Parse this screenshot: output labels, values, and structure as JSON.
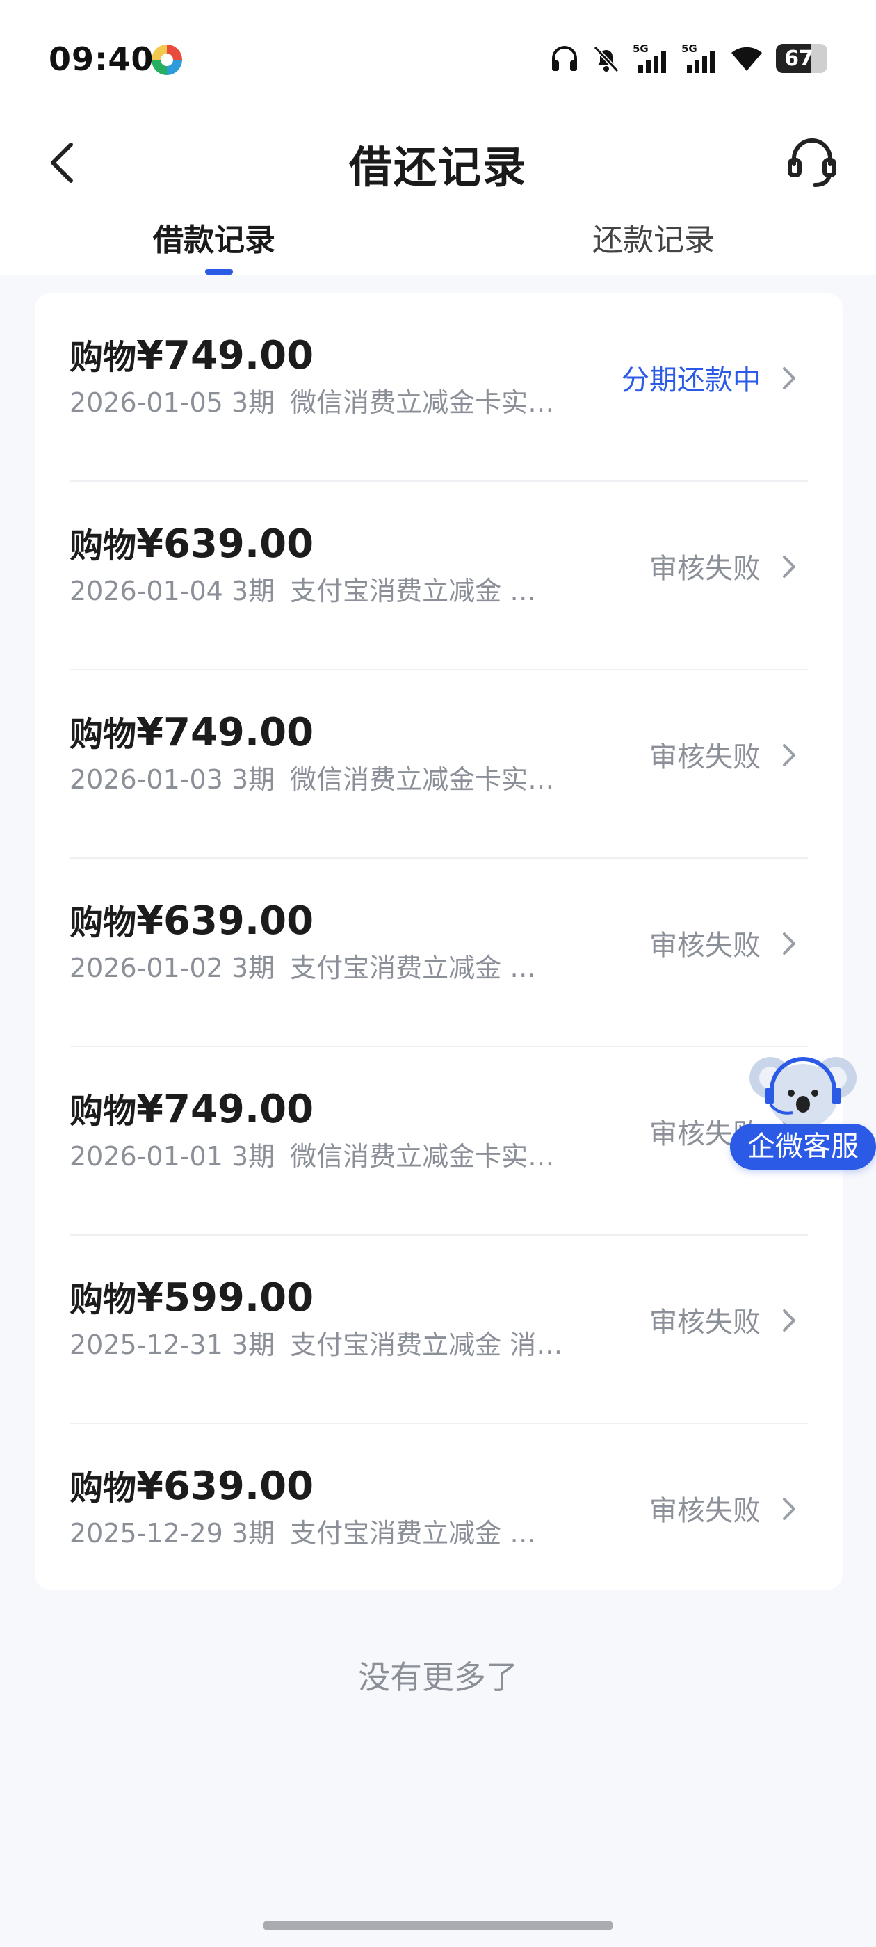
{
  "status_bar": {
    "time": "09:40",
    "network_1": "5G",
    "network_2": "5G",
    "battery_level": 67,
    "battery_label": "67",
    "icons": [
      "app-icon",
      "headphones-icon",
      "mute-bell-icon",
      "signal-5g-icon",
      "signal-5g-icon",
      "wifi-icon",
      "battery-icon"
    ]
  },
  "header": {
    "title": "借还记录",
    "back_icon": "chevron-left-icon",
    "support_icon": "headset-icon"
  },
  "tabs": [
    {
      "label": "借款记录",
      "active": true
    },
    {
      "label": "还款记录",
      "active": false
    }
  ],
  "records": [
    {
      "prefix": "购物",
      "amount": "¥749.00",
      "date": "2026-01-05",
      "term": "3期",
      "desc": "微信消费立减金卡实…",
      "status": "分期还款中",
      "status_active": true
    },
    {
      "prefix": "购物",
      "amount": "¥639.00",
      "date": "2026-01-04",
      "term": "3期",
      "desc": "支付宝消费立减金 …",
      "status": "审核失败",
      "status_active": false
    },
    {
      "prefix": "购物",
      "amount": "¥749.00",
      "date": "2026-01-03",
      "term": "3期",
      "desc": "微信消费立减金卡实…",
      "status": "审核失败",
      "status_active": false
    },
    {
      "prefix": "购物",
      "amount": "¥639.00",
      "date": "2026-01-02",
      "term": "3期",
      "desc": "支付宝消费立减金 …",
      "status": "审核失败",
      "status_active": false
    },
    {
      "prefix": "购物",
      "amount": "¥749.00",
      "date": "2026-01-01",
      "term": "3期",
      "desc": "微信消费立减金卡实…",
      "status": "审核失败",
      "status_active": false
    },
    {
      "prefix": "购物",
      "amount": "¥599.00",
      "date": "2025-12-31",
      "term": "3期",
      "desc": "支付宝消费立减金 消…",
      "status": "审核失败",
      "status_active": false
    },
    {
      "prefix": "购物",
      "amount": "¥639.00",
      "date": "2025-12-29",
      "term": "3期",
      "desc": "支付宝消费立减金 …",
      "status": "审核失败",
      "status_active": false
    }
  ],
  "footer": {
    "no_more": "没有更多了"
  },
  "float_service": {
    "label": "企微客服",
    "icon": "koala-mascot-icon"
  },
  "colors": {
    "accent": "#2b5ae6",
    "muted": "#8b8f98",
    "background": "#f7f8fc"
  }
}
